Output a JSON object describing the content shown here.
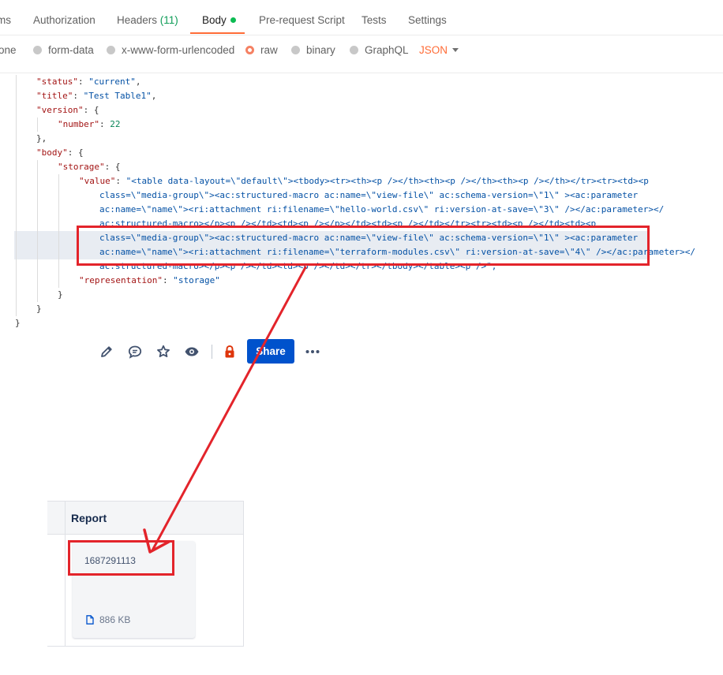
{
  "tabs": [
    {
      "label": "ms"
    },
    {
      "label": "Authorization"
    },
    {
      "label": "Headers",
      "count": "(11)"
    },
    {
      "label": "Body"
    },
    {
      "label": "Pre-request Script"
    },
    {
      "label": "Tests"
    },
    {
      "label": "Settings"
    }
  ],
  "body_types": [
    {
      "label": "one"
    },
    {
      "label": "form-data"
    },
    {
      "label": "x-www-form-urlencoded"
    },
    {
      "label": "raw",
      "selected": true
    },
    {
      "label": "binary"
    },
    {
      "label": "GraphQL"
    }
  ],
  "format_select": {
    "value": "JSON"
  },
  "code": {
    "l1": {
      "key": "\"status\"",
      "val": "\"current\""
    },
    "l2": {
      "key": "\"title\"",
      "val": "\"Test Table1\""
    },
    "l3": {
      "key": "\"version\"",
      "open": "{"
    },
    "l4": {
      "key": "\"number\"",
      "val": "22"
    },
    "l5": "},",
    "l6": {
      "key": "\"body\"",
      "open": "{"
    },
    "l7": {
      "key": "\"storage\"",
      "open": "{"
    },
    "l8": {
      "key": "\"value\"",
      "val": "\"<table data-layout=\\\"default\\\"><tbody><tr><th><p /></th><th><p /></th><th><p /></th></tr><tr><td><p"
    },
    "l9": "class=\\\"media-group\\\"><ac:structured-macro ac:name=\\\"view-file\\\" ac:schema-version=\\\"1\\\" ><ac:parameter",
    "l10": "ac:name=\\\"name\\\"><ri:attachment ri:filename=\\\"hello-world.csv\\\" ri:version-at-save=\\\"3\\\" /></ac:parameter></",
    "l11": "ac:structured-macro></p><p /></td><td><p /></p></td><td><p /></td></tr><tr><td><p /></td><td><p",
    "l12": "class=\\\"media-group\\\"><ac:structured-macro ac:name=\\\"view-file\\\" ac:schema-version=\\\"1\\\" ><ac:parameter",
    "l13": "ac:name=\\\"name\\\"><ri:attachment ri:filename=\\\"terraform-modules.csv\\\" ri:version-at-save=\\\"4\\\" /></ac:parameter></",
    "l14": "ac:structured-macro></p><p /></td><td><p /></td></tr></tbody></table><p />\",",
    "l15": {
      "key": "\"representation\"",
      "val": "\"storage\""
    },
    "l16": "}",
    "l17": "}",
    "l18": "}"
  },
  "toolbar": {
    "icons": [
      "pencil-icon",
      "comment-icon",
      "star-icon",
      "eye-icon",
      "lock-icon",
      "more-icon"
    ],
    "share_label": "Share",
    "more_label": "•••"
  },
  "table": {
    "header": "Report",
    "card_title": "1687291113",
    "file_size": "886 KB"
  },
  "colors": {
    "accent": "#ff6c37",
    "annotation_red": "#e3242b",
    "share_blue": "#0052cc"
  }
}
